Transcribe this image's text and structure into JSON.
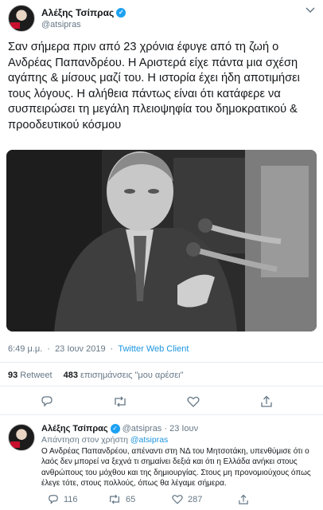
{
  "tweet": {
    "author_name": "Αλέξης Τσίπρας",
    "handle": "@atsipras",
    "text": "Σαν σήμερα πριν από 23 χρόνια έφυγε από τη ζωή ο Ανδρέας Παπανδρέου. Η Αριστερά είχε πάντα μια σχέση αγάπης & μίσους μαζί του. Η ιστορία έχει ήδη αποτιμήσει τους λόγους. Η αλήθεια πάντως είναι ότι κατάφερε να συσπειρώσει τη μεγάλη πλειοψηφία του δημοκρατικού & προοδευτικού κόσμου",
    "time": "6:49 μ.μ.",
    "date": "23 Ιουν 2019",
    "separator": "·",
    "client": "Twitter Web Client",
    "retweets": "93",
    "retweets_label": "Retweet",
    "likes": "483",
    "likes_label": "επισημάνσεις \"μου αρέσει\""
  },
  "reply": {
    "author_name": "Αλέξης Τσίπρας",
    "handle_date": "@atsipras · 23 Ιουν",
    "replying_prefix": "Απάντηση στον χρήστη",
    "replying_handle": "@atsipras",
    "text": "Ο Ανδρέας Παπανδρέου, απέναντι στη ΝΔ του Μητσοτάκη, υπενθύμισε ότι ο λαός δεν μπορεί να ξεχνά τι σημαίνει δεξιά και ότι η Ελλάδα ανήκει στους ανθρώπους του μόχθου και της δημιουργίας. Στους μη προνομιούχους όπως έλεγε τότε, στους πολλούς, όπως θα λέγαμε σήμερα.",
    "reply_count": "116",
    "retweet_count": "65",
    "like_count": "287"
  },
  "icons": {
    "verified": "verified-badge-icon",
    "more": "chevron-down-icon",
    "reply": "reply-icon",
    "retweet": "retweet-icon",
    "like": "heart-icon",
    "share": "share-icon"
  },
  "colors": {
    "link": "#1b95e0",
    "muted": "#657786",
    "verified": "#1da1f2"
  }
}
